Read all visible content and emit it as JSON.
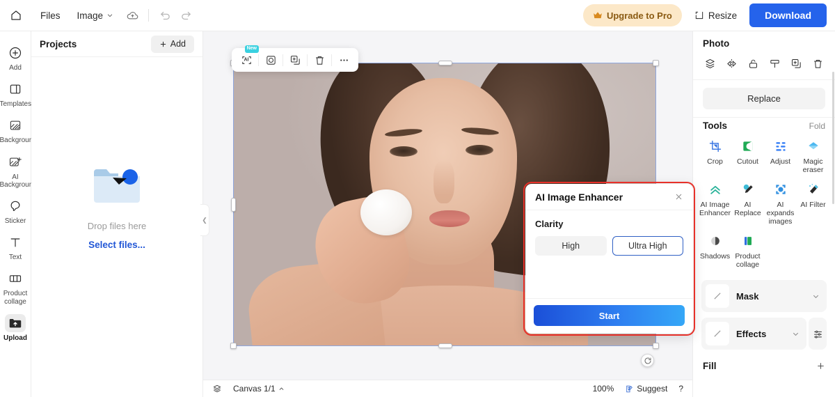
{
  "topbar": {
    "home_icon": "home-icon",
    "files_label": "Files",
    "image_label": "Image",
    "chevron_icon": "chevron-down-icon",
    "cloud_icon": "cloud-sync-icon",
    "undo_icon": "undo-icon",
    "redo_icon": "redo-icon",
    "upgrade_label": "Upgrade to Pro",
    "upgrade_icon": "crown-icon",
    "upgrade_bg": "#fce8c8",
    "resize_label": "Resize",
    "resize_icon": "resize-icon",
    "download_label": "Download",
    "download_bg": "#2563eb"
  },
  "rail": {
    "items": [
      {
        "label": "Add",
        "icon": "plus-circle-icon",
        "active": false
      },
      {
        "label": "Templates",
        "icon": "templates-icon",
        "active": false
      },
      {
        "label": "Background",
        "icon": "background-icon",
        "active": false
      },
      {
        "label": "AI\nBackground",
        "icon": "ai-background-icon",
        "active": false
      },
      {
        "label": "Sticker",
        "icon": "sticker-icon",
        "active": false
      },
      {
        "label": "Text",
        "icon": "text-icon",
        "active": false
      },
      {
        "label": "Product\ncollage",
        "icon": "product-collage-icon",
        "active": false
      },
      {
        "label": "Upload",
        "icon": "upload-icon",
        "active": true
      }
    ]
  },
  "projects": {
    "title": "Projects",
    "add_label": "Add",
    "add_icon": "plus-icon",
    "drop_text": "Drop files here",
    "select_files_label": "Select files...",
    "folder_icon": "folder-upload-illustration",
    "collapse_icon": "chevron-left-icon"
  },
  "canvas": {
    "object_toolbar": [
      {
        "name": "ai-tool-button",
        "icon": "ai-frame-icon",
        "badge": "New"
      },
      {
        "name": "crop-frame-button",
        "icon": "crop-frame-icon",
        "badge": ""
      },
      {
        "name": "duplicate-button",
        "icon": "duplicate-icon",
        "badge": ""
      },
      {
        "name": "delete-button",
        "icon": "trash-icon",
        "badge": ""
      },
      {
        "name": "more-button",
        "icon": "ellipsis-icon",
        "badge": ""
      }
    ],
    "rotate_icon": "rotate-icon",
    "selection_color": "#8ea7df",
    "background_color": "#f5f5f7"
  },
  "dialog": {
    "title": "AI Image Enhancer",
    "close_icon": "close-icon",
    "section_label": "Clarity",
    "options": [
      {
        "label": "High",
        "selected": false
      },
      {
        "label": "Ultra High",
        "selected": true
      }
    ],
    "start_label": "Start",
    "highlight_color": "#e8312a",
    "selected_border": "#2f5fc4"
  },
  "bottombar": {
    "layers_icon": "layers-icon",
    "canvas_label": "Canvas 1/1",
    "canvas_chevron": "chevron-up-icon",
    "zoom_label": "100%",
    "suggest_label": "Suggest",
    "suggest_icon": "suggest-icon",
    "help_label": "?"
  },
  "rightpanel": {
    "photo_title": "Photo",
    "photo_actions": [
      {
        "name": "layer-order-button",
        "icon": "layers-icon"
      },
      {
        "name": "flip-button",
        "icon": "flip-horizontal-icon"
      },
      {
        "name": "lock-button",
        "icon": "unlock-icon"
      },
      {
        "name": "format-painter-button",
        "icon": "format-painter-icon"
      },
      {
        "name": "duplicate-button",
        "icon": "duplicate-icon"
      },
      {
        "name": "delete-button",
        "icon": "trash-icon"
      }
    ],
    "replace_label": "Replace",
    "tools_title": "Tools",
    "fold_label": "Fold",
    "tools": [
      {
        "label": "Crop",
        "icon": "crop-icon",
        "color": "#2f6fe0"
      },
      {
        "label": "Cutout",
        "icon": "cutout-icon",
        "color": "#1faa55"
      },
      {
        "label": "Adjust",
        "icon": "adjust-icon",
        "color": "#3b82f6"
      },
      {
        "label": "Magic\neraser",
        "icon": "magic-eraser-icon",
        "color": "#4db8f0"
      },
      {
        "label": "AI Image\nEnhancer",
        "icon": "ai-enhancer-icon",
        "color": "#2bb39a"
      },
      {
        "label": "AI\nReplace",
        "icon": "ai-replace-icon",
        "color": "#3dbbd6"
      },
      {
        "label": "AI\nexpands\nimages",
        "icon": "ai-expand-icon",
        "color": "#2f8fe0"
      },
      {
        "label": "AI Filter",
        "icon": "ai-filter-icon",
        "color": "#4fc3e8"
      },
      {
        "label": "Shadows",
        "icon": "shadows-icon",
        "color": "#7a7a7a"
      },
      {
        "label": "Product\ncollage",
        "icon": "product-collage-icon",
        "color": "#2f6fe0"
      }
    ],
    "accordions": [
      {
        "label": "Mask",
        "thumb_icon": "diagonal-line-icon",
        "chevron": "chevron-down-icon",
        "has_extra": false,
        "extra_icon": ""
      },
      {
        "label": "Effects",
        "thumb_icon": "diagonal-line-icon",
        "chevron": "chevron-down-icon",
        "has_extra": true,
        "extra_icon": "sliders-icon"
      }
    ],
    "fill_label": "Fill",
    "fill_add_icon": "plus-icon"
  }
}
